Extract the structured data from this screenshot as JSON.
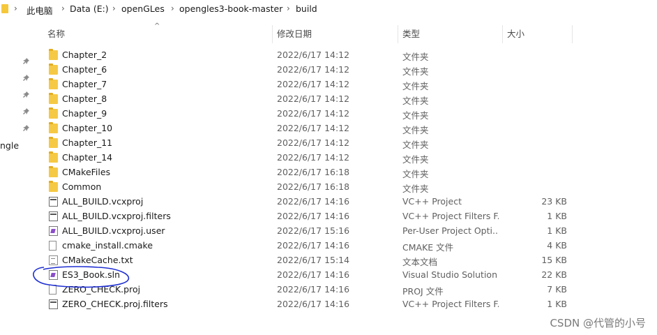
{
  "breadcrumb": {
    "items": [
      "此电脑",
      "Data (E:)",
      "openGLes",
      "opengles3-book-master",
      "build"
    ]
  },
  "nav_pane": {
    "partial_label": "ngle"
  },
  "columns": {
    "name": "名称",
    "date": "修改日期",
    "type": "类型",
    "size": "大小"
  },
  "files": [
    {
      "name": "Chapter_2",
      "date": "2022/6/17 14:12",
      "type": "文件夹",
      "size": "",
      "icon": "folder-icon"
    },
    {
      "name": "Chapter_6",
      "date": "2022/6/17 14:12",
      "type": "文件夹",
      "size": "",
      "icon": "folder-icon"
    },
    {
      "name": "Chapter_7",
      "date": "2022/6/17 14:12",
      "type": "文件夹",
      "size": "",
      "icon": "folder-icon"
    },
    {
      "name": "Chapter_8",
      "date": "2022/6/17 14:12",
      "type": "文件夹",
      "size": "",
      "icon": "folder-icon"
    },
    {
      "name": "Chapter_9",
      "date": "2022/6/17 14:12",
      "type": "文件夹",
      "size": "",
      "icon": "folder-icon"
    },
    {
      "name": "Chapter_10",
      "date": "2022/6/17 14:12",
      "type": "文件夹",
      "size": "",
      "icon": "folder-icon"
    },
    {
      "name": "Chapter_11",
      "date": "2022/6/17 14:12",
      "type": "文件夹",
      "size": "",
      "icon": "folder-icon"
    },
    {
      "name": "Chapter_14",
      "date": "2022/6/17 14:12",
      "type": "文件夹",
      "size": "",
      "icon": "folder-icon"
    },
    {
      "name": "CMakeFiles",
      "date": "2022/6/17 16:18",
      "type": "文件夹",
      "size": "",
      "icon": "folder-icon"
    },
    {
      "name": "Common",
      "date": "2022/6/17 16:18",
      "type": "文件夹",
      "size": "",
      "icon": "folder-icon"
    },
    {
      "name": "ALL_BUILD.vcxproj",
      "date": "2022/6/17 14:16",
      "type": "VC++ Project",
      "size": "23 KB",
      "icon": "vcxproj-icon"
    },
    {
      "name": "ALL_BUILD.vcxproj.filters",
      "date": "2022/6/17 14:16",
      "type": "VC++ Project Filters F...",
      "size": "1 KB",
      "icon": "filters-icon"
    },
    {
      "name": "ALL_BUILD.vcxproj.user",
      "date": "2022/6/17 15:16",
      "type": "Per-User Project Opti...",
      "size": "1 KB",
      "icon": "vs-user-icon"
    },
    {
      "name": "cmake_install.cmake",
      "date": "2022/6/17 14:16",
      "type": "CMAKE 文件",
      "size": "4 KB",
      "icon": "file-icon"
    },
    {
      "name": "CMakeCache.txt",
      "date": "2022/6/17 15:14",
      "type": "文本文档",
      "size": "15 KB",
      "icon": "text-file-icon"
    },
    {
      "name": "ES3_Book.sln",
      "date": "2022/6/17 14:16",
      "type": "Visual Studio Solution",
      "size": "22 KB",
      "icon": "vs-solution-icon"
    },
    {
      "name": "ZERO_CHECK.proj",
      "date": "2022/6/17 14:16",
      "type": "PROJ 文件",
      "size": "7 KB",
      "icon": "file-icon"
    },
    {
      "name": "ZERO_CHECK.proj.filters",
      "date": "2022/6/17 14:16",
      "type": "VC++ Project Filters F...",
      "size": "1 KB",
      "icon": "filters-icon"
    }
  ],
  "watermark": "CSDN @代管的小号",
  "colors": {
    "folder": "#f6c945",
    "annotation": "#1f2fd1",
    "vs_purple": "#8b4ec9"
  }
}
